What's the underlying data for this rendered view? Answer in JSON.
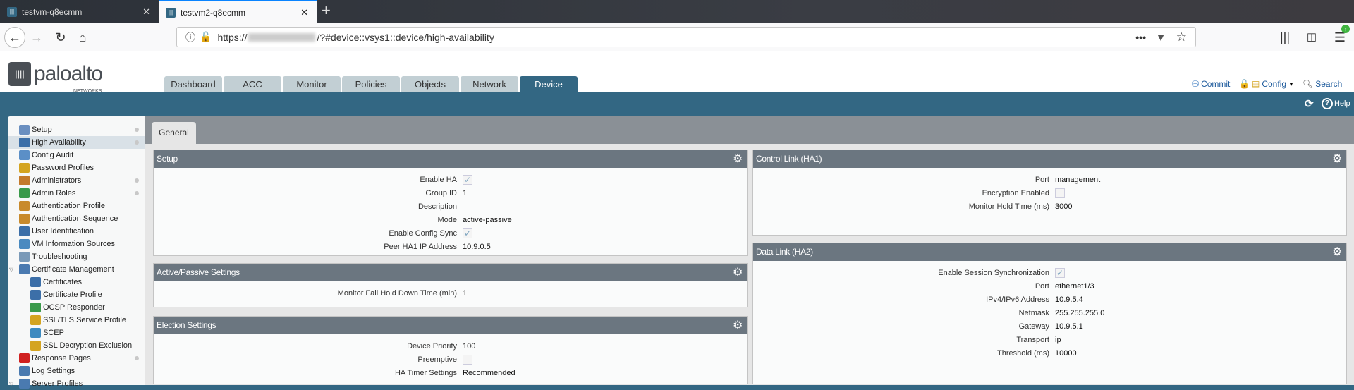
{
  "browser": {
    "tabs": [
      {
        "title": "testvm-q8ecmm",
        "active": false
      },
      {
        "title": "testvm2-q8ecmm",
        "active": true
      }
    ],
    "url_prefix": "https://",
    "url_suffix": "/?#device::vsys1::device/high-availability"
  },
  "app": {
    "logo": "paloalto",
    "logo_sub": "NETWORKS",
    "nav_tabs": [
      "Dashboard",
      "ACC",
      "Monitor",
      "Policies",
      "Objects",
      "Network",
      "Device"
    ],
    "active_tab": "Device",
    "header_links": {
      "commit": "Commit",
      "config": "Config",
      "search": "Search"
    },
    "help": "Help"
  },
  "sidebar": {
    "items": [
      {
        "label": "Setup",
        "icon": "setup-icon",
        "color": "#6a8fc0",
        "dot": true,
        "level": 0
      },
      {
        "label": "High Availability",
        "icon": "high-availability-icon",
        "color": "#3c6fa8",
        "dot": true,
        "level": 0,
        "selected": true
      },
      {
        "label": "Config Audit",
        "icon": "config-audit-icon",
        "color": "#5b8fc7",
        "level": 0
      },
      {
        "label": "Password Profiles",
        "icon": "password-profiles-icon",
        "color": "#d4a420",
        "level": 0
      },
      {
        "label": "Administrators",
        "icon": "administrators-icon",
        "color": "#c47a2c",
        "dot": true,
        "level": 0
      },
      {
        "label": "Admin Roles",
        "icon": "admin-roles-icon",
        "color": "#3a9a4a",
        "dot": true,
        "level": 0
      },
      {
        "label": "Authentication Profile",
        "icon": "authentication-profile-icon",
        "color": "#c88a2c",
        "level": 0
      },
      {
        "label": "Authentication Sequence",
        "icon": "authentication-sequence-icon",
        "color": "#c88a2c",
        "level": 0
      },
      {
        "label": "User Identification",
        "icon": "user-identification-icon",
        "color": "#3c6fa8",
        "level": 0
      },
      {
        "label": "VM Information Sources",
        "icon": "vm-information-sources-icon",
        "color": "#4a8ac0",
        "level": 0
      },
      {
        "label": "Troubleshooting",
        "icon": "troubleshooting-icon",
        "color": "#7a9ab8",
        "level": 0
      },
      {
        "label": "Certificate Management",
        "icon": "certificate-management-icon",
        "color": "#4a7ab0",
        "level": 0,
        "expanded": true
      },
      {
        "label": "Certificates",
        "icon": "certificates-icon",
        "color": "#3c6fa8",
        "level": 1
      },
      {
        "label": "Certificate Profile",
        "icon": "certificate-profile-icon",
        "color": "#3c6fa8",
        "level": 1
      },
      {
        "label": "OCSP Responder",
        "icon": "ocsp-responder-icon",
        "color": "#3a9a4a",
        "level": 1
      },
      {
        "label": "SSL/TLS Service Profile",
        "icon": "lock-icon",
        "color": "#d4a420",
        "level": 1
      },
      {
        "label": "SCEP",
        "icon": "scep-icon",
        "color": "#3c8ac0",
        "level": 1
      },
      {
        "label": "SSL Decryption Exclusion",
        "icon": "lock-icon",
        "color": "#d4a420",
        "level": 1
      },
      {
        "label": "Response Pages",
        "icon": "response-pages-icon",
        "color": "#d02020",
        "dot": true,
        "level": 0
      },
      {
        "label": "Log Settings",
        "icon": "log-settings-icon",
        "color": "#4a7ab0",
        "level": 0
      },
      {
        "label": "Server Profiles",
        "icon": "server-profiles-icon",
        "color": "#4a7ab0",
        "level": 0,
        "expanded": true
      }
    ]
  },
  "main": {
    "tab": "General",
    "panels": {
      "setup": {
        "title": "Setup",
        "rows": [
          {
            "label": "Enable HA",
            "type": "check",
            "checked": true
          },
          {
            "label": "Group ID",
            "value": "1"
          },
          {
            "label": "Description",
            "value": ""
          },
          {
            "label": "Mode",
            "value": "active-passive"
          },
          {
            "label": "Enable Config Sync",
            "type": "check",
            "checked": true
          },
          {
            "label": "Peer HA1 IP Address",
            "value": "10.9.0.5"
          }
        ]
      },
      "active_passive": {
        "title": "Active/Passive Settings",
        "rows": [
          {
            "label": "Monitor Fail Hold Down Time (min)",
            "value": "1"
          }
        ]
      },
      "election": {
        "title": "Election Settings",
        "rows": [
          {
            "label": "Device Priority",
            "value": "100"
          },
          {
            "label": "Preemptive",
            "type": "check",
            "checked": false
          },
          {
            "label": "HA Timer Settings",
            "value": "Recommended"
          }
        ]
      },
      "control_link": {
        "title": "Control Link (HA1)",
        "rows": [
          {
            "label": "Port",
            "value": "management"
          },
          {
            "label": "Encryption Enabled",
            "type": "check",
            "checked": false
          },
          {
            "label": "Monitor Hold Time (ms)",
            "value": "3000"
          }
        ]
      },
      "data_link": {
        "title": "Data Link (HA2)",
        "rows": [
          {
            "label": "Enable Session Synchronization",
            "type": "check",
            "checked": true
          },
          {
            "label": "Port",
            "value": "ethernet1/3"
          },
          {
            "label": "IPv4/IPv6 Address",
            "value": "10.9.5.4"
          },
          {
            "label": "Netmask",
            "value": "255.255.255.0"
          },
          {
            "label": "Gateway",
            "value": "10.9.5.1"
          },
          {
            "label": "Transport",
            "value": "ip"
          },
          {
            "label": "Threshold (ms)",
            "value": "10000"
          }
        ]
      }
    }
  }
}
